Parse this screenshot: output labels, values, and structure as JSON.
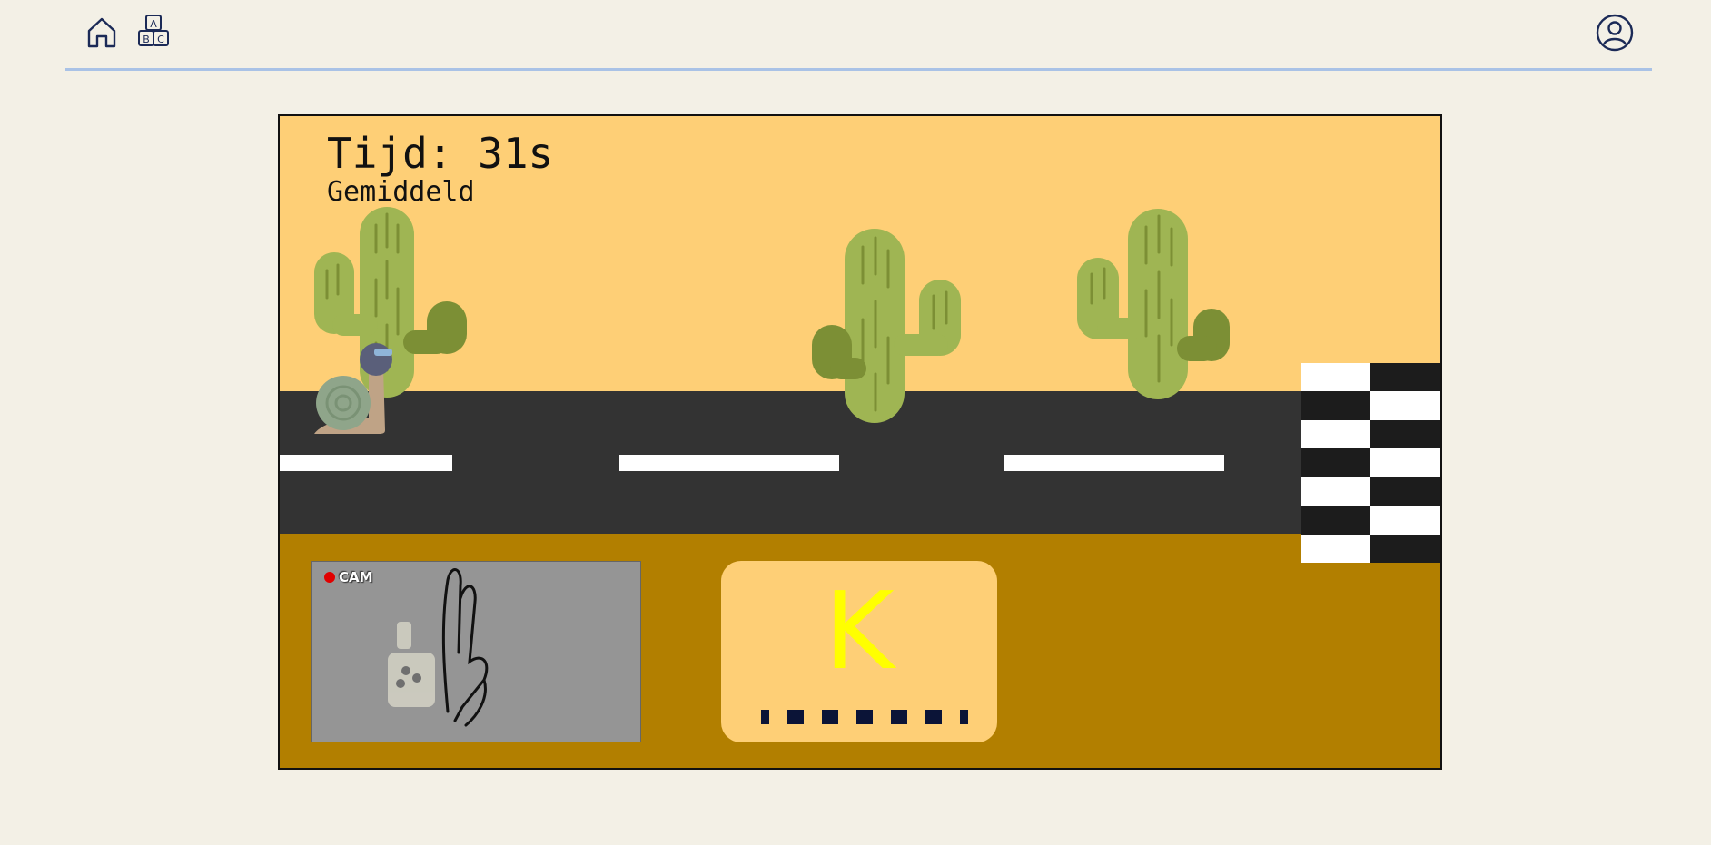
{
  "nav": {
    "home_icon": "home-icon",
    "alphabet_icon": "abc-blocks-icon",
    "alphabet_letters": [
      "A",
      "B",
      "C"
    ],
    "profile_icon": "user-circle-icon",
    "icon_color": "#1b2a57",
    "divider_color": "#a9c2e6"
  },
  "game": {
    "timer": "Tijd: 31s",
    "difficulty": "Gemiddeld",
    "camera_label": "CAM",
    "target_letter": "K",
    "letter_color": "#ffff00",
    "progress_marks": 7,
    "colors": {
      "sky": "#fecf76",
      "road": "#333333",
      "ground": "#b27f00",
      "cactus": "#9fb553",
      "cactus_dark": "#7c8f35"
    }
  }
}
